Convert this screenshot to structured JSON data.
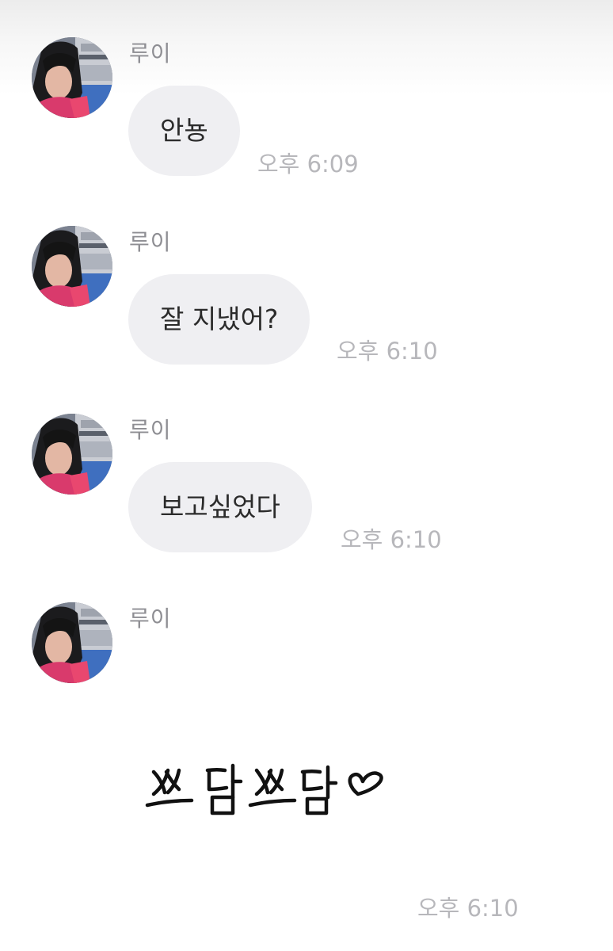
{
  "messages": [
    {
      "sender": "루이",
      "text": "안뇽",
      "time": "오후 6:09"
    },
    {
      "sender": "루이",
      "text": "잘 지냈어?",
      "time": "오후 6:10"
    },
    {
      "sender": "루이",
      "text": "보고싶었다",
      "time": "오후 6:10"
    },
    {
      "sender": "루이",
      "sticker_text": "쓰담쓰담 ♡",
      "time": "오후 6:10"
    }
  ],
  "colors": {
    "bubble": "#efeff2",
    "sender": "#8e8e93",
    "time": "#b7b7bb",
    "text": "#2b2b2b",
    "ink": "#111111"
  },
  "icons": {
    "avatar": "profile-photo",
    "sticker": "handwritten-pat-heart-sticker"
  }
}
